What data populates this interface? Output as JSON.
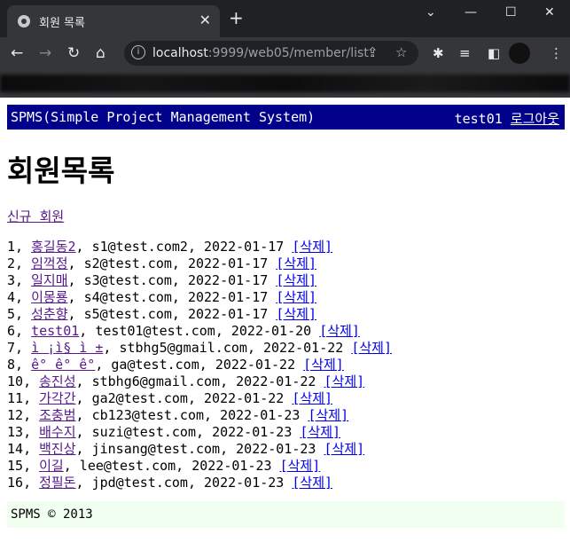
{
  "browser": {
    "tab_title": "회원 목록",
    "url_host": "localhost",
    "url_rest": ":9999/web05/member/list"
  },
  "header": {
    "brand": "SPMS(Simple Project Management System)",
    "user": "test01",
    "logout": "로그아웃"
  },
  "page_title": "회원목록",
  "new_member_link": "신규 회원",
  "delete_label": "[삭제]",
  "members": [
    {
      "no": "1",
      "name": "홍길동2",
      "email": "s1@test.com2",
      "date": "2022-01-17"
    },
    {
      "no": "2",
      "name": "임꺽정",
      "email": "s2@test.com",
      "date": "2022-01-17"
    },
    {
      "no": "3",
      "name": "일지매",
      "email": "s3@test.com",
      "date": "2022-01-17"
    },
    {
      "no": "4",
      "name": "이몽룡",
      "email": "s4@test.com",
      "date": "2022-01-17"
    },
    {
      "no": "5",
      "name": "성춘향",
      "email": "s5@test.com",
      "date": "2022-01-17"
    },
    {
      "no": "6",
      "name": "test01",
      "email": "test01@test.com",
      "date": "2022-01-20"
    },
    {
      "no": "7",
      "name": "ì ¡ì§ ì ±",
      "email": "stbhg5@gmail.com",
      "date": "2022-01-22"
    },
    {
      "no": "8",
      "name": "ê° ê° ê°",
      "email": "ga@test.com",
      "date": "2022-01-22"
    },
    {
      "no": "10",
      "name": "송진성",
      "email": "stbhg6@gmail.com",
      "date": "2022-01-22"
    },
    {
      "no": "11",
      "name": "가각간",
      "email": "ga2@test.com",
      "date": "2022-01-22"
    },
    {
      "no": "12",
      "name": "조충범",
      "email": "cb123@test.com",
      "date": "2022-01-23"
    },
    {
      "no": "13",
      "name": "배수지",
      "email": "suzi@test.com",
      "date": "2022-01-23"
    },
    {
      "no": "14",
      "name": "백진상",
      "email": "jinsang@test.com",
      "date": "2022-01-23"
    },
    {
      "no": "15",
      "name": "이길",
      "email": "lee@test.com",
      "date": "2022-01-23"
    },
    {
      "no": "16",
      "name": "정필돈",
      "email": "jpd@test.com",
      "date": "2022-01-23"
    }
  ],
  "footer": "SPMS © 2013"
}
